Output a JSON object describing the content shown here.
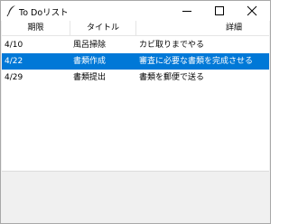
{
  "window": {
    "title": "To Doリスト",
    "icon": "feather-icon"
  },
  "columns": [
    "期限",
    "タイトル",
    "詳細"
  ],
  "rows": [
    {
      "date": "4/10",
      "title": "風呂掃除",
      "detail": "カビ取りまでやる",
      "selected": false
    },
    {
      "date": "4/22",
      "title": "書類作成",
      "detail": "審査に必要な書類を完成させる",
      "selected": true
    },
    {
      "date": "4/29",
      "title": "書類提出",
      "detail": "書類を郵便で送る",
      "selected": false
    }
  ],
  "colors": {
    "selection": "#0078d7",
    "window_bg": "#f0f0f0"
  }
}
